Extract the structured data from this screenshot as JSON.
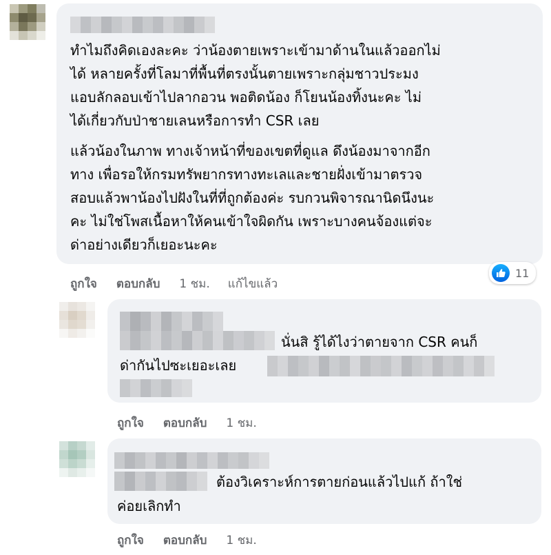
{
  "comments": [
    {
      "lines": [
        "ทำไมถึงคิดเองละคะ ว่าน้องตายเพราะเข้ามาด้านในแล้วออกไม่",
        "ได้ หลายครั้งที่โลมาที่พื้นที่ตรงนั้นตายเพราะกลุ่มชาวประมง",
        "แอบลักลอบเข้าไปลากอวน พอติดน้อง ก็โยนน้องทิ้งนะคะ ไม่",
        "ได้เกี่ยวกับป่าชายเลนหรือการทำ CSR เลย"
      ],
      "lines2": [
        "แล้วน้องในภาพ ทางเจ้าหน้าที่ของเขตที่ดูแล ดึงน้องมาจากอีก",
        "ทาง เพื่อรอให้กรมทรัพยากรทางทะเลและชายฝั่งเข้ามาตรวจ",
        "สอบแล้วพาน้องไปฝังในที่ที่ถูกต้องค่ะ รบกวนพิจารณานิดนึงนะ",
        "คะ ไม่ใช่โพสเนื้อหาให้คนเข้าใจผิดกัน เพราะบางคนจ้องแต่จะ",
        "ด่าอย่างเดียวก็เยอะนะคะ"
      ],
      "reaction_count": "11",
      "like_label": "ถูกใจ",
      "reply_label": "ตอบกลับ",
      "time": "1 ชม.",
      "edited": "แก้ไขแล้ว"
    },
    {
      "line1_tail": "นั่นสิ รู้ได้ไงว่าตายจาก CSR คนก็",
      "line2_head": "ด่ากันไปซะเยอะเลย",
      "like_label": "ถูกใจ",
      "reply_label": "ตอบกลับ",
      "time": "1 ชม."
    },
    {
      "line1_tail": "ต้องวิเคราะห์การตายก่อนแล้วไปแก้ ถ้าใช่",
      "line2": "ค่อยเลิกทำ",
      "like_label": "ถูกใจ",
      "reply_label": "ตอบกลับ",
      "time": "1 ชม."
    }
  ],
  "colors": {
    "bubble": "#f0f2f5",
    "meta_text": "#65676b",
    "like_blue": "#1877f2"
  },
  "icons": {
    "reaction": "like-thumb-icon"
  }
}
